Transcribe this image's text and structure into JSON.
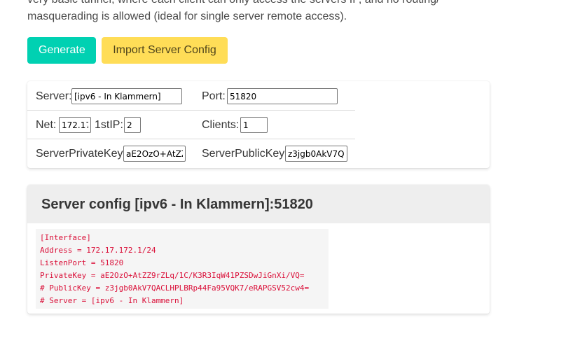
{
  "intro": {
    "line1": "very basic tunnel, where each client can only access the servers IP, and no routing/",
    "line2": "masquerading is allowed (ideal for single server remote access)."
  },
  "buttons": {
    "generate": "Generate",
    "import": "Import Server Config"
  },
  "params": {
    "server_label": "Server:",
    "server_value": "[ipv6 - In Klammern]",
    "port_label": "Port:",
    "port_value": "51820",
    "net_label": "Net:",
    "net_value": "172.17",
    "firstip_label": "1stIP:",
    "firstip_value": "2",
    "clients_label": "Clients:",
    "clients_value": "1",
    "private_key_label": "ServerPrivateKey:",
    "private_key_value": "aE2OzO+AtZZ",
    "public_key_label": "ServerPublicKey:",
    "public_key_value": "z3jgb0AkV7Q,"
  },
  "config": {
    "title": "Server config [ipv6 - In Klammern]:51820",
    "lines": [
      "[Interface]",
      "Address = 172.17.172.1/24",
      "ListenPort = 51820",
      "PrivateKey = aE2OzO+AtZZ9rZLq/1C/K3R3IqW41PZSDwJiGnXi/VQ=",
      "# PublicKey = z3jgb0AkV7QACLHPLBRp44Fa95VQK7/eRAPGSV52cw4=",
      "# Server = [ipv6 - In Klammern]"
    ]
  }
}
